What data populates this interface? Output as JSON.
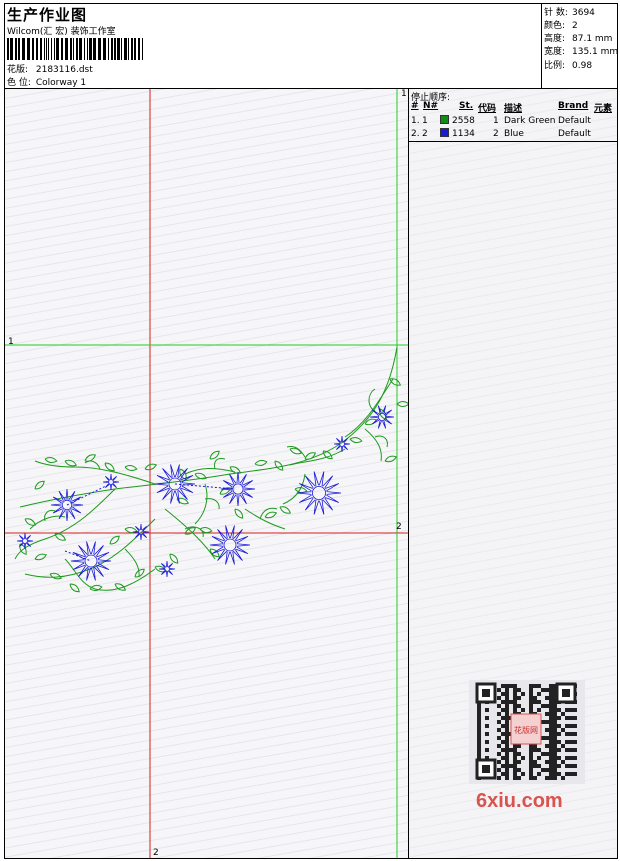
{
  "header": {
    "title": "生产作业图",
    "company": "Wilcom(汇 宏) 装饰工作室",
    "design_label": "花版:",
    "design_value": "2183116.dst",
    "colorway_label": "色 位:",
    "colorway_value": "Colorway 1"
  },
  "stats": [
    {
      "label": "针 数:",
      "value": "3694"
    },
    {
      "label": "颜色:",
      "value": "2"
    },
    {
      "label": "高度:",
      "value": "87.1 mm"
    },
    {
      "label": "宽度:",
      "value": "135.1 mm"
    },
    {
      "label": "比例:",
      "value": "0.98"
    }
  ],
  "stop_sequence": {
    "heading": "停止顺序:",
    "columns": [
      "#",
      "N#",
      "St.",
      "代码",
      "描述",
      "Brand",
      "元素"
    ],
    "rows": [
      {
        "num": "1.",
        "n": "1",
        "stitches": "2558",
        "code": "1",
        "desc": "Dark Green",
        "brand": "Default",
        "color": "#138a13"
      },
      {
        "num": "2.",
        "n": "2",
        "stitches": "1134",
        "code": "2",
        "desc": "Blue",
        "brand": "Default",
        "color": "#1a1ad8"
      }
    ]
  },
  "guides": {
    "v1_label": "1",
    "h1_label": "1",
    "h2_label": "2",
    "v2_label": "2"
  },
  "colors": {
    "stem_green": "#1e9a1e",
    "flower_blue": "#1a1ad8",
    "guide_red": "#d42020",
    "guide_green": "#22cc22"
  },
  "watermark": {
    "text": "6xiu.com",
    "stamp": "花版网"
  }
}
